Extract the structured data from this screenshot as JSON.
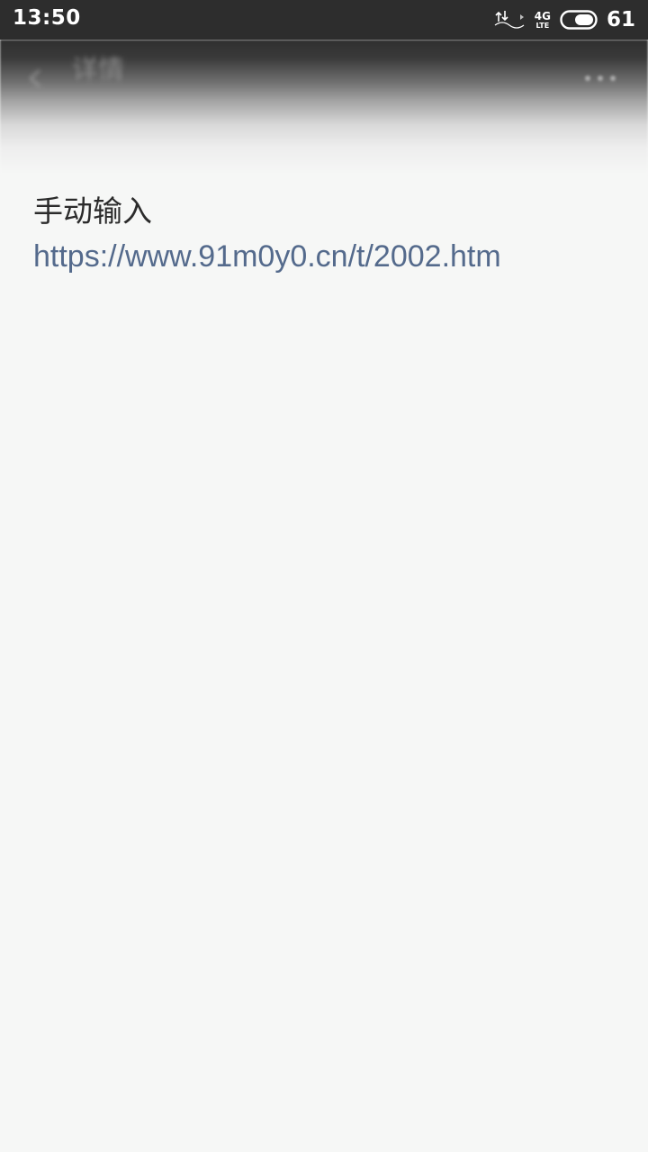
{
  "status_bar": {
    "time": "13:50",
    "network_icon": "data-transfer-icon",
    "signal_gen": "4G",
    "signal_sub": "LTE",
    "battery_icon": "battery-icon",
    "battery_level": "61"
  },
  "title_bar": {
    "back_icon": "back-arrow-icon",
    "title": "详情",
    "more_icon": "more-dots-icon"
  },
  "content": {
    "source_label": "手动输入",
    "url": "https://www.91m0y0.cn/t/2002.htm"
  },
  "colors": {
    "status_bar_bg": "#2d2d2d",
    "page_bg": "#f6f7f6",
    "label_text": "#2b2b2b",
    "link_text": "#546a8c"
  }
}
